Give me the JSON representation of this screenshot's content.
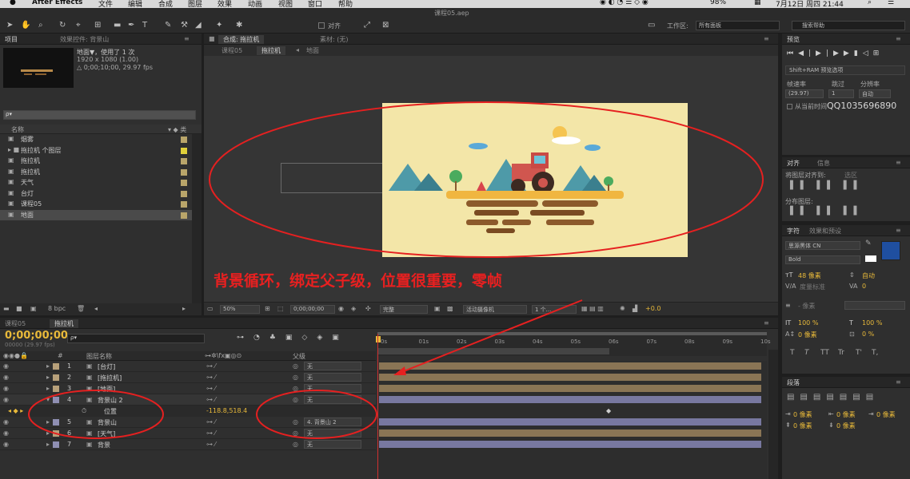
{
  "menubar": {
    "app_name": "After Effects",
    "items": [
      "文件",
      "编辑",
      "合成",
      "图层",
      "效果",
      "动画",
      "视图",
      "窗口",
      "帮助"
    ],
    "battery": "98%",
    "datetime": "7月12日 周四 21:44",
    "search_label": "搜索帮助"
  },
  "title": "课程05.aep",
  "toolbar": {
    "align_label": "对齐",
    "workspace_label": "工作区:",
    "workspace_value": "所有面板",
    "search_placeholder": "搜索帮助"
  },
  "project_panel": {
    "tab_project": "项目",
    "tab_effects": "效果控件: 背景山",
    "item_name": "地面▼，使用了 1 次",
    "item_size": "1920 x 1080 (1.00)",
    "item_duration": "△ 0;00;10;00, 29.97 fps",
    "search_placeholder": "ρ▾",
    "col_name": "名称",
    "items": [
      {
        "label": "烟雾",
        "color": "#b9a56a"
      },
      {
        "label": "拖拉机 个图层",
        "color": "#e0d03a"
      },
      {
        "label": "拖拉机",
        "color": "#b9a56a"
      },
      {
        "label": "拖拉机",
        "color": "#b9a56a"
      },
      {
        "label": "天气",
        "color": "#b9a56a"
      },
      {
        "label": "台灯",
        "color": "#b9a56a"
      },
      {
        "label": "课程05",
        "color": "#b9a56a"
      },
      {
        "label": "地面",
        "color": "#b9a56a"
      }
    ],
    "bpc": "8 bpc"
  },
  "comp_panel": {
    "tab_comp": "合成: 拖拉机",
    "tab_footage": "素材: (无)",
    "crumb_1": "课程05",
    "crumb_2": "拖拉机",
    "crumb_3": "地面",
    "zoom": "50%",
    "timecode": "0;00;00;00",
    "quality": "完整",
    "camera": "活动摄像机",
    "views": "1 个...",
    "exposure": "+0.0"
  },
  "annotation": {
    "caption": "背景循环，绑定父子级，位置很重要，零帧",
    "watermark": "QQ1035696890"
  },
  "preview_panel": {
    "title": "预览",
    "ram_option": "Shift+RAM 预览选项",
    "fps_label": "帧速率",
    "skip_label": "跳过",
    "res_label": "分辨率",
    "fps_value": "(29.97)",
    "skip_value": "1",
    "res_value": "自动",
    "from_current": "从当前时间"
  },
  "align_panel": {
    "tab_align": "对齐",
    "tab_info": "信息",
    "align_to_label": "将图层对齐到:",
    "align_to_value": "选区",
    "distribute_label": "分布图层:"
  },
  "char_panel": {
    "tab_char": "字符",
    "tab_effects": "效果和预设",
    "font": "思源黑体 CN",
    "style": "Bold",
    "size": "48 像素",
    "leading": "自动",
    "kerning": "度量标准",
    "tracking": "0",
    "stroke": "- 像素",
    "vscale": "100 %",
    "hscale": "100 %",
    "baseline": "0 像素",
    "tsume": "0 %",
    "style_buttons": [
      "T",
      "T",
      "TT",
      "Tr",
      "T'",
      "T,"
    ]
  },
  "para_panel": {
    "title": "段落",
    "indent_1": "0 像素",
    "indent_2": "0 像素",
    "indent_3": "0 像素",
    "space_1": "0 像素",
    "space_2": "0 像素"
  },
  "timeline": {
    "tab_1": "课程05",
    "tab_2": "拖拉机",
    "timecode": "0;00;00;00",
    "fps": "00000 (29.97 fps)",
    "search_placeholder": "ρ▾",
    "col_hash": "#",
    "col_layer_name": "图层名称",
    "col_parent": "父级",
    "ruler": [
      "0s",
      "01s",
      "02s",
      "03s",
      "04s",
      "05s",
      "06s",
      "07s",
      "08s",
      "09s",
      "10s"
    ],
    "layers": [
      {
        "num": "1",
        "name": "[台灯]",
        "parent": "无",
        "color": "#b7a07a",
        "bar": "#8a7555"
      },
      {
        "num": "2",
        "name": "[拖拉机]",
        "parent": "无",
        "color": "#b7a07a",
        "bar": "#8a7555"
      },
      {
        "num": "3",
        "name": "[地面]",
        "parent": "无",
        "color": "#b7a07a",
        "bar": "#8a7555"
      },
      {
        "num": "4",
        "name": "背景山 2",
        "parent": "无",
        "color": "#8f8fb3",
        "bar": "#7878a0"
      },
      {
        "num": "5",
        "name": "背景山",
        "parent": "4. 背景山 2",
        "color": "#8f8fb3",
        "bar": "#7878a0"
      },
      {
        "num": "6",
        "name": "[天气]",
        "parent": "无",
        "color": "#b7a07a",
        "bar": "#8a7555"
      },
      {
        "num": "7",
        "name": "背景",
        "parent": "无",
        "color": "#8f8fb3",
        "bar": "#7878a0"
      }
    ],
    "position_label": "位置",
    "position_value": "-118.8,518.4"
  }
}
